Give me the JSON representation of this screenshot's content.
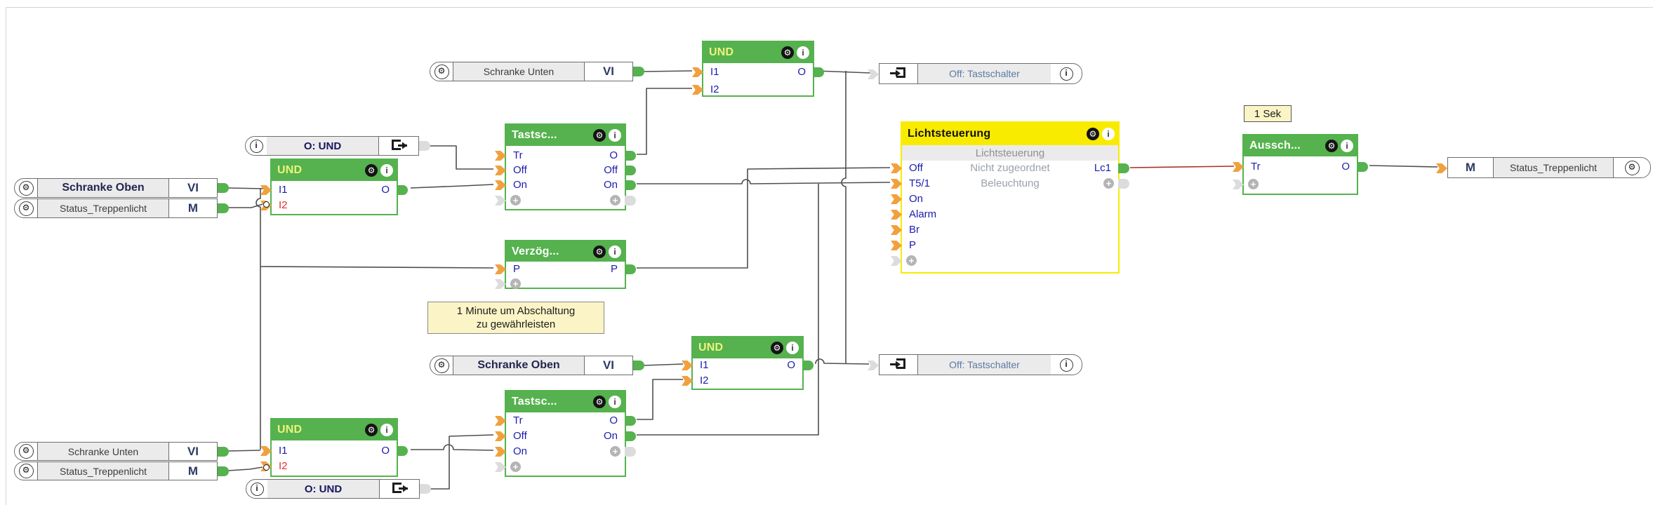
{
  "app": {
    "name": "logic-diagram-canvas"
  },
  "icons": {
    "gear": "⚙",
    "info": "i",
    "plus": "+"
  },
  "colors": {
    "block_green": "#55b24e",
    "title_yellow": "#eef27d",
    "title_white": "#ffffff",
    "yellow_header": "#f8eb00",
    "wire": "#4f4f4f",
    "wire_red": "#a93226",
    "port_text": "#1c1cae",
    "port_text_red": "#e03030",
    "connector_in": "#f0a13e",
    "connector_out": "#55b24e",
    "connector_idle": "#dcdcdc",
    "note_bg": "#fbf4c6"
  },
  "blocks": [
    {
      "id": "und_top",
      "title": "UND",
      "header": "green",
      "title_tint": "yellow",
      "left": [
        {
          "row": 0,
          "label": "I1",
          "conn": "in"
        },
        {
          "row": 1,
          "label": "I2",
          "conn": "in"
        }
      ],
      "right": [
        {
          "row": 0,
          "label": "O",
          "conn": "out"
        }
      ]
    },
    {
      "id": "und_left",
      "title": "UND",
      "header": "green",
      "title_tint": "yellow",
      "left": [
        {
          "row": 0,
          "label": "I1",
          "conn": "in"
        },
        {
          "row": 1,
          "label": "I2",
          "conn": "in",
          "negated": true,
          "red": true
        }
      ],
      "right": [
        {
          "row": 0,
          "label": "O",
          "conn": "out"
        }
      ]
    },
    {
      "id": "tast_top",
      "title": "Tastsc...",
      "header": "green",
      "title_tint": "white",
      "left": [
        {
          "row": 0,
          "label": "Tr",
          "conn": "in"
        },
        {
          "row": 1,
          "label": "Off",
          "conn": "in"
        },
        {
          "row": 2,
          "label": "On",
          "conn": "in"
        },
        {
          "row": 3,
          "plus": true,
          "conn": "plus-in"
        }
      ],
      "right": [
        {
          "row": 0,
          "label": "O",
          "conn": "out"
        },
        {
          "row": 1,
          "label": "Off",
          "conn": "out"
        },
        {
          "row": 2,
          "label": "On",
          "conn": "out"
        },
        {
          "row": 3,
          "plus": true,
          "conn": "plus-out"
        }
      ]
    },
    {
      "id": "verz",
      "title": "Verzög...",
      "header": "green",
      "title_tint": "white",
      "left": [
        {
          "row": 0,
          "label": "P",
          "conn": "in"
        },
        {
          "row": 1,
          "plus": true,
          "conn": "plus-in"
        }
      ],
      "right": [
        {
          "row": 0,
          "label": "P",
          "conn": "out"
        }
      ]
    },
    {
      "id": "licht",
      "title": "Lichtsteuerung",
      "header": "yellow",
      "subtitle": "Lichtsteuerung",
      "center": [
        {
          "row": 0,
          "label": "Nicht zugeordnet"
        },
        {
          "row": 1,
          "label": "Beleuchtung"
        }
      ],
      "left": [
        {
          "row": 0,
          "label": "Off",
          "conn": "in"
        },
        {
          "row": 1,
          "label": "T5/1",
          "conn": "in"
        },
        {
          "row": 2,
          "label": "On",
          "conn": "in"
        },
        {
          "row": 3,
          "label": "Alarm",
          "conn": "in"
        },
        {
          "row": 4,
          "label": "Br",
          "conn": "in"
        },
        {
          "row": 5,
          "label": "P",
          "conn": "in"
        },
        {
          "row": 6,
          "plus": true,
          "conn": "plus-in"
        }
      ],
      "right": [
        {
          "row": 0,
          "label": "Lc1",
          "conn": "out"
        },
        {
          "row": 1,
          "plus": true,
          "conn": "plus-out"
        }
      ]
    },
    {
      "id": "aus",
      "title": "Aussch...",
      "header": "green",
      "title_tint": "white",
      "left": [
        {
          "row": 0,
          "label": "Tr",
          "conn": "in"
        },
        {
          "row": 1,
          "plus": true,
          "conn": "plus-in"
        }
      ],
      "right": [
        {
          "row": 0,
          "label": "O",
          "conn": "out"
        }
      ]
    },
    {
      "id": "und_bmid",
      "title": "UND",
      "header": "green",
      "title_tint": "yellow",
      "left": [
        {
          "row": 0,
          "label": "I1",
          "conn": "in"
        },
        {
          "row": 1,
          "label": "I2",
          "conn": "in"
        }
      ],
      "right": [
        {
          "row": 0,
          "label": "O",
          "conn": "out"
        }
      ]
    },
    {
      "id": "tast_bot",
      "title": "Tastsc...",
      "header": "green",
      "title_tint": "white",
      "left": [
        {
          "row": 0,
          "label": "Tr",
          "conn": "in"
        },
        {
          "row": 1,
          "label": "Off",
          "conn": "in"
        },
        {
          "row": 2,
          "label": "On",
          "conn": "in"
        },
        {
          "row": 3,
          "plus": true,
          "conn": "plus-in"
        }
      ],
      "right": [
        {
          "row": 0,
          "label": "O",
          "conn": "out"
        },
        {
          "row": 1,
          "label": "On",
          "conn": "out"
        },
        {
          "row": 2,
          "plus": true,
          "conn": "plus-out"
        }
      ]
    },
    {
      "id": "und_bleft",
      "title": "UND",
      "header": "green",
      "title_tint": "yellow",
      "left": [
        {
          "row": 0,
          "label": "I1",
          "conn": "in"
        },
        {
          "row": 1,
          "label": "I2",
          "conn": "in",
          "negated": true,
          "red": true
        }
      ],
      "right": [
        {
          "row": 0,
          "label": "O",
          "conn": "out"
        }
      ]
    }
  ],
  "io_pills": [
    {
      "id": "p_su_top",
      "label": "Schranke Unten",
      "type": "VI",
      "dir": "source",
      "bold": false
    },
    {
      "id": "p_so_left",
      "label": "Schranke Oben",
      "type": "VI",
      "dir": "source",
      "bold": true
    },
    {
      "id": "p_st_left",
      "label": "Status_Treppenlicht",
      "type": "M",
      "dir": "source",
      "bold": false
    },
    {
      "id": "p_so_bot",
      "label": "Schranke Oben",
      "type": "VI",
      "dir": "source",
      "bold": true
    },
    {
      "id": "p_su_bot",
      "label": "Schranke Unten",
      "type": "VI",
      "dir": "source",
      "bold": false
    },
    {
      "id": "p_st_bot",
      "label": "Status_Treppenlicht",
      "type": "M",
      "dir": "source",
      "bold": false
    },
    {
      "id": "p_status_out",
      "label": "Status_Treppenlicht",
      "type": "M",
      "dir": "sink"
    }
  ],
  "ref_pills": [
    {
      "id": "r_out_top",
      "label": "Off: Tastschalter",
      "dir": "sink"
    },
    {
      "id": "r_out_bot",
      "label": "Off: Tastschalter",
      "dir": "sink"
    },
    {
      "id": "r_src_top",
      "label": "O: UND",
      "dir": "source"
    },
    {
      "id": "r_src_bot",
      "label": "O: UND",
      "dir": "source"
    }
  ],
  "notes": [
    {
      "id": "n_1sek",
      "lines": [
        "1 Sek"
      ]
    },
    {
      "id": "n_minute",
      "lines": [
        "1 Minute um Abschaltung",
        "zu gewährleisten"
      ]
    }
  ]
}
